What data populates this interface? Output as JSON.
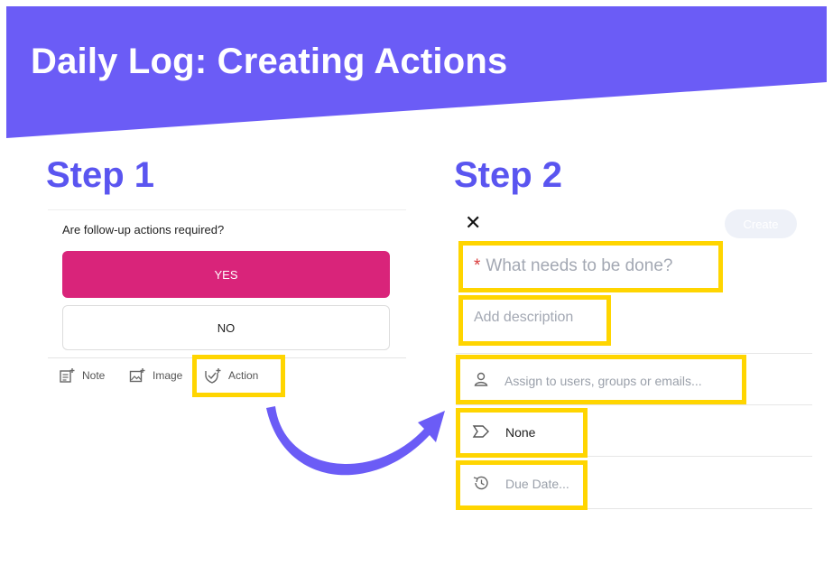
{
  "slide": {
    "title": "Daily Log: Creating Actions",
    "colors": {
      "banner": "#6b5cf6",
      "heading": "#5a55f0",
      "highlight": "#ffd500",
      "yes_button": "#d9247a",
      "arrow": "#6b5cf6"
    }
  },
  "step1": {
    "heading": "Step 1",
    "question": "Are follow-up actions required?",
    "yes_label": "YES",
    "no_label": "NO",
    "toolbar": [
      {
        "label": "Note",
        "icon": "note-add-icon"
      },
      {
        "label": "Image",
        "icon": "image-add-icon"
      },
      {
        "label": "Action",
        "icon": "action-add-icon"
      }
    ]
  },
  "step2": {
    "heading": "Step 2",
    "close_icon": "close-icon",
    "create_label": "Create",
    "title_placeholder": "What needs to be done?",
    "required_marker": "*",
    "description_placeholder": "Add description",
    "assign_placeholder": "Assign to users, groups or emails...",
    "assign_icon": "person-icon",
    "label_value": "None",
    "label_icon": "label-tag-icon",
    "due_placeholder": "Due Date...",
    "due_icon": "clock-history-icon"
  }
}
